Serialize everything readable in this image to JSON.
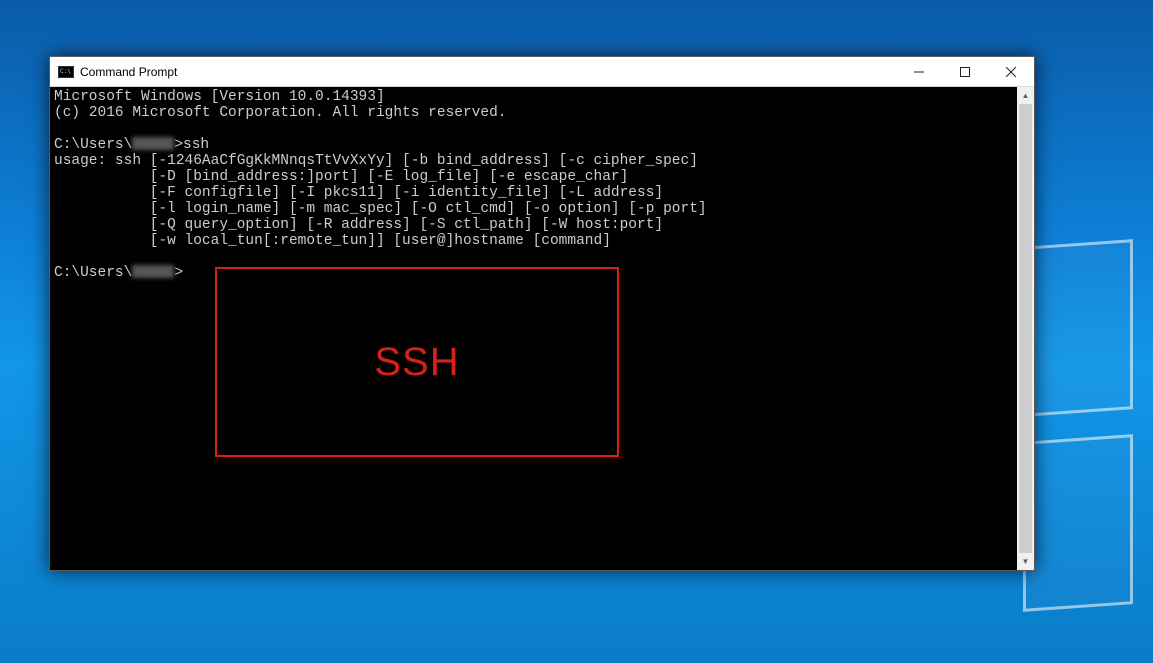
{
  "window": {
    "title": "Command Prompt"
  },
  "console": {
    "line1": "Microsoft Windows [Version 10.0.14393]",
    "line2": "(c) 2016 Microsoft Corporation. All rights reserved.",
    "prompt1_prefix": "C:\\Users\\",
    "prompt1_suffix": ">ssh",
    "usage1": "usage: ssh [-1246AaCfGgKkMNnqsTtVvXxYy] [-b bind_address] [-c cipher_spec]",
    "usage2": "           [-D [bind_address:]port] [-E log_file] [-e escape_char]",
    "usage3": "           [-F configfile] [-I pkcs11] [-i identity_file] [-L address]",
    "usage4": "           [-l login_name] [-m mac_spec] [-O ctl_cmd] [-o option] [-p port]",
    "usage5": "           [-Q query_option] [-R address] [-S ctl_path] [-W host:port]",
    "usage6": "           [-w local_tun[:remote_tun]] [user@]hostname [command]",
    "prompt2_prefix": "C:\\Users\\",
    "prompt2_suffix": ">"
  },
  "annotation": {
    "label": "SSH"
  }
}
